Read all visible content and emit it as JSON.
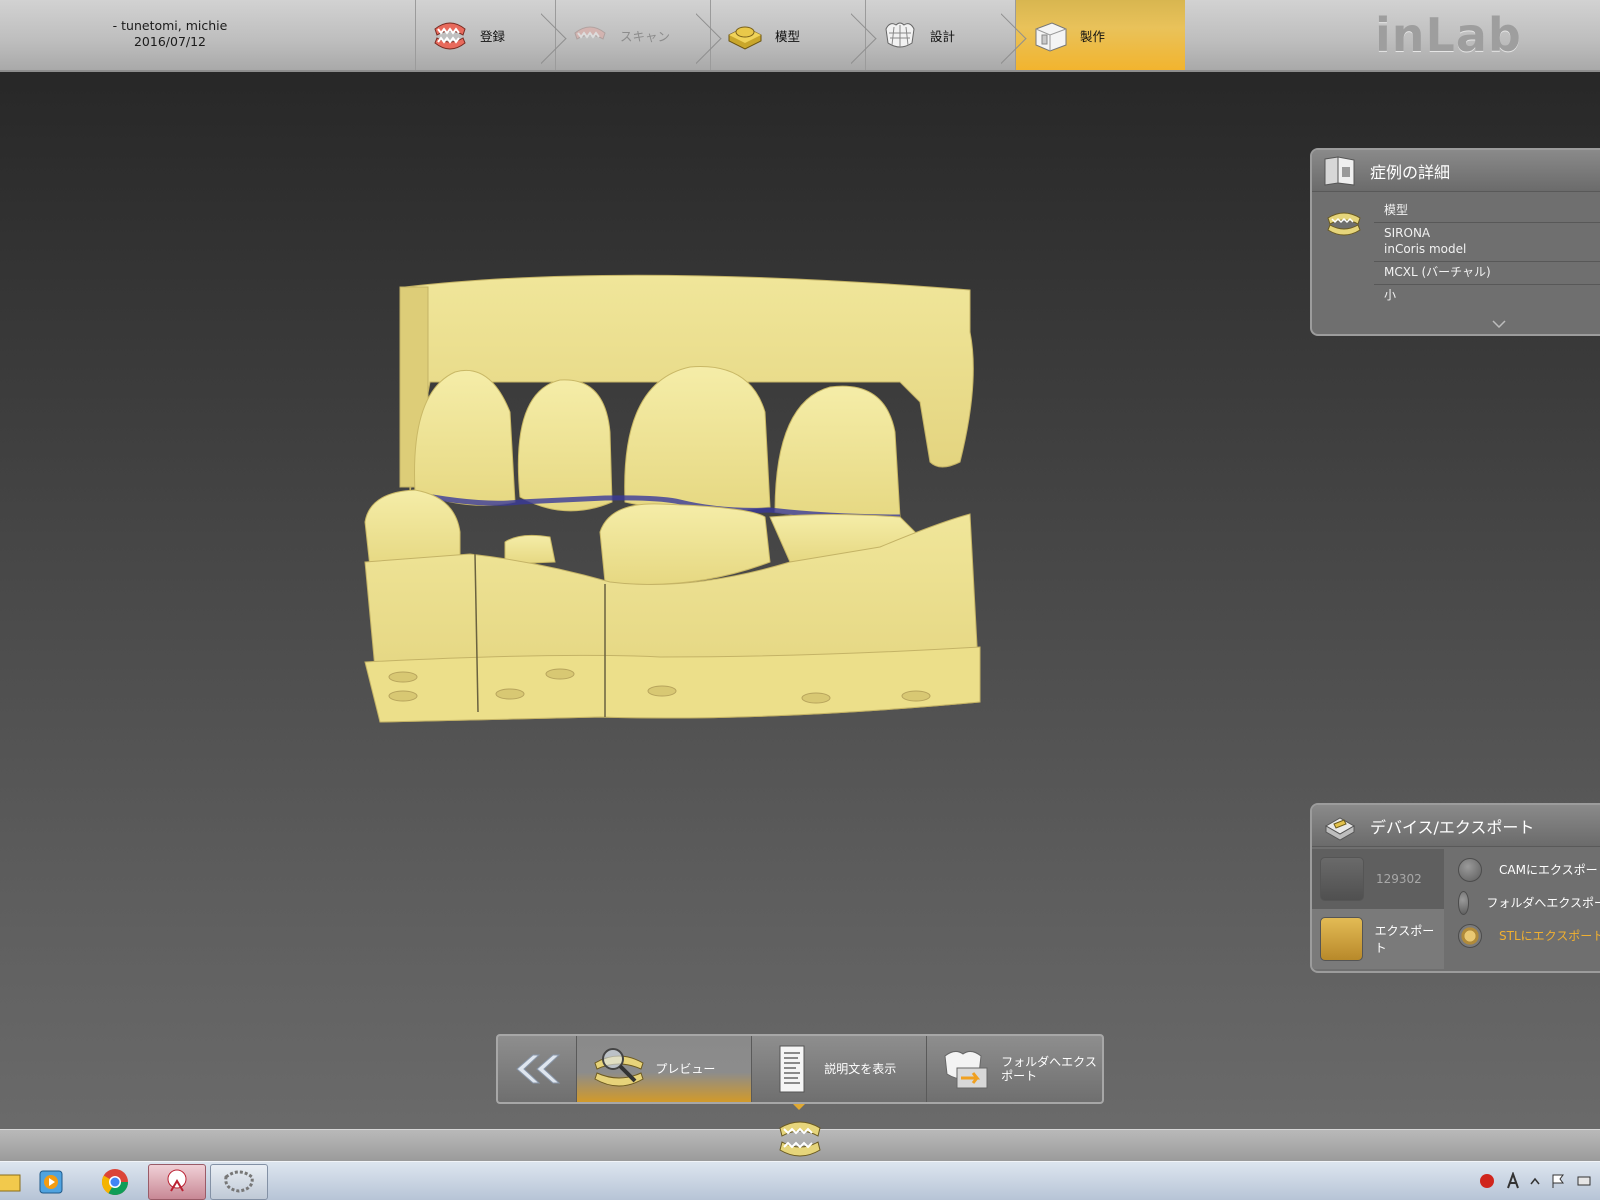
{
  "header": {
    "patient_name": "- tunetomi, michie",
    "date": "2016/07/12",
    "app_logo": "inLab",
    "steps": [
      {
        "label": "登録",
        "icon": "jaw-open-icon",
        "state": "done"
      },
      {
        "label": "スキャン",
        "icon": "scan-jaw-icon",
        "state": "disabled"
      },
      {
        "label": "模型",
        "icon": "model-base-icon",
        "state": "done"
      },
      {
        "label": "設計",
        "icon": "crown-design-icon",
        "state": "done"
      },
      {
        "label": "製作",
        "icon": "milling-unit-icon",
        "state": "active"
      }
    ]
  },
  "case_details": {
    "title": "症例の詳細",
    "icon": "case-book-icon",
    "section_icon": "dental-model-icon",
    "rows": [
      "模型",
      "SIRONA",
      "inCoris model",
      "MCXL (バーチャル)",
      "小"
    ]
  },
  "device_export": {
    "title": "デバイス/エクスポート",
    "icon": "device-export-icon",
    "devices": [
      {
        "label": "129302",
        "state": "disabled",
        "icon": "milling-machine-icon"
      },
      {
        "label": "エクスポート",
        "state": "selected",
        "icon": "export-model-icon"
      }
    ],
    "options": [
      {
        "label": "CAMにエクスポート",
        "selected": false
      },
      {
        "label": "フォルダへエクスポート",
        "selected": false
      },
      {
        "label": "STLにエクスポート",
        "selected": true
      }
    ]
  },
  "toolbar": {
    "back_icon": "double-chevron-left-icon",
    "buttons": [
      {
        "label": "プレビュー",
        "icon": "preview-magnifier-icon",
        "active": true
      },
      {
        "label": "説明文を表示",
        "icon": "document-icon",
        "active": false
      },
      {
        "label": "フォルダへエクスポート",
        "icon": "folder-export-icon",
        "active": false
      }
    ]
  },
  "colors": {
    "accent": "#f2b42e",
    "model": "#ece089",
    "selected_text": "#f0b030"
  },
  "taskbar": {
    "apps": [
      "explorer-icon",
      "media-player-icon",
      "chrome-icon",
      "dental-tool-icon",
      "dental-arch-icon"
    ]
  }
}
